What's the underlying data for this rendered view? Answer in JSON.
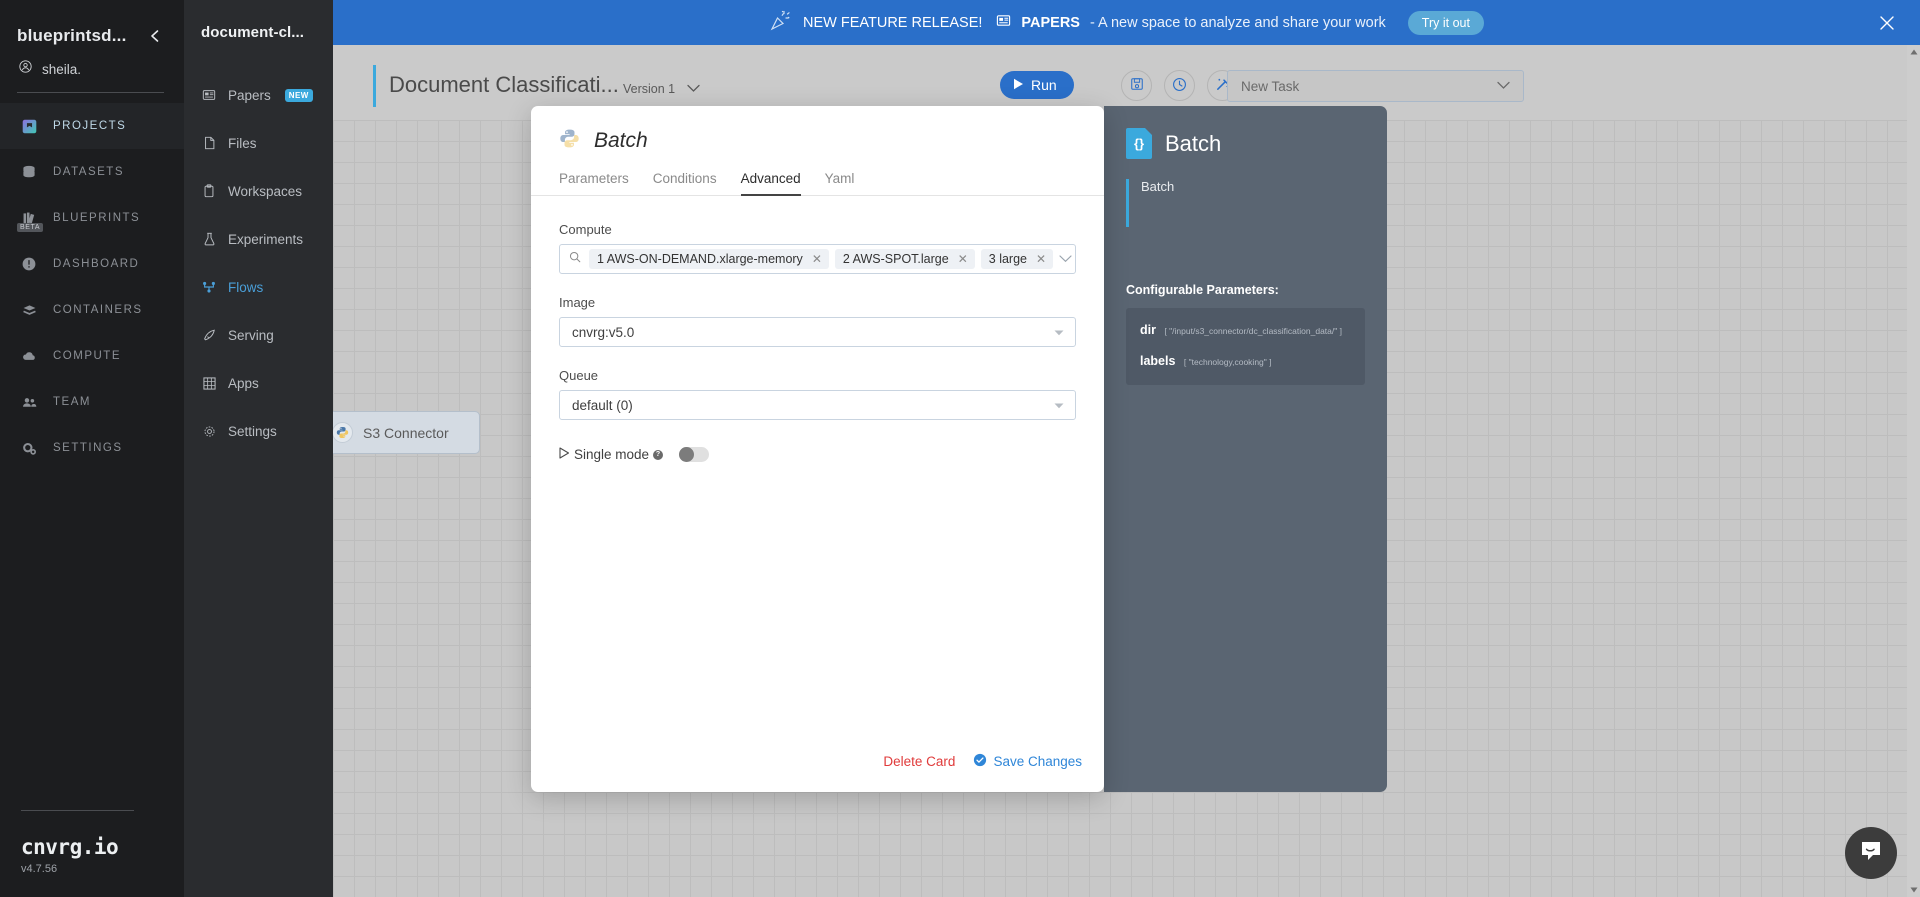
{
  "sidebar_primary": {
    "org_name": "blueprintsd...",
    "user_name": "sheila.",
    "collapse_icon": "chevron-left-icon",
    "user_icon": "user-circle-icon",
    "items": [
      {
        "label": "PROJECTS",
        "icon": "projects-icon",
        "active": true,
        "badge": ""
      },
      {
        "label": "DATASETS",
        "icon": "database-icon",
        "active": false,
        "badge": ""
      },
      {
        "label": "BLUEPRINTS",
        "icon": "books-icon",
        "active": false,
        "badge": "BETA"
      },
      {
        "label": "DASHBOARD",
        "icon": "gauge-icon",
        "active": false,
        "badge": ""
      },
      {
        "label": "CONTAINERS",
        "icon": "containers-icon",
        "active": false,
        "badge": ""
      },
      {
        "label": "COMPUTE",
        "icon": "cloud-icon",
        "active": false,
        "badge": ""
      },
      {
        "label": "TEAM",
        "icon": "team-icon",
        "active": false,
        "badge": ""
      },
      {
        "label": "SETTINGS",
        "icon": "gears-icon",
        "active": false,
        "badge": ""
      }
    ],
    "brand": "cnvrg.io",
    "version": "v4.7.56"
  },
  "sidebar_secondary": {
    "project_title": "document-cl...",
    "items": [
      {
        "label": "Papers",
        "icon": "papers-icon",
        "active": false,
        "badge": "NEW"
      },
      {
        "label": "Files",
        "icon": "file-icon",
        "active": false,
        "badge": ""
      },
      {
        "label": "Workspaces",
        "icon": "clipboard-icon",
        "active": false,
        "badge": ""
      },
      {
        "label": "Experiments",
        "icon": "flask-icon",
        "active": false,
        "badge": ""
      },
      {
        "label": "Flows",
        "icon": "flows-icon",
        "active": true,
        "badge": ""
      },
      {
        "label": "Serving",
        "icon": "rocket-icon",
        "active": false,
        "badge": ""
      },
      {
        "label": "Apps",
        "icon": "grid-icon",
        "active": false,
        "badge": ""
      },
      {
        "label": "Settings",
        "icon": "gear-icon",
        "active": false,
        "badge": ""
      }
    ]
  },
  "banner": {
    "icon": "party-popper-icon",
    "headline": "NEW FEATURE RELEASE!",
    "papers_icon": "papers-icon",
    "product": "PAPERS",
    "tagline": "- A new space to analyze and share your work",
    "cta_label": "Try it out",
    "close_icon": "close-icon",
    "bg_color": "#2a6fc9",
    "cta_color": "#5aa9d6"
  },
  "toolbar": {
    "flow_title": "Document Classificati...",
    "version_label": "Version 1",
    "version_caret": "chevron-down-icon",
    "run_label": "Run",
    "run_icon": "play-icon",
    "accent_color": "#3ba9dd",
    "run_color": "#2a6fc9",
    "icon_buttons": [
      {
        "name": "save-flow-button",
        "icon": "save-icon"
      },
      {
        "name": "history-button",
        "icon": "clock-icon"
      },
      {
        "name": "magic-button",
        "icon": "magic-wand-icon"
      },
      {
        "name": "code-button",
        "icon": "code-brackets-icon"
      }
    ],
    "new_task_value": "New Task",
    "new_task_caret": "chevron-down-icon"
  },
  "canvas": {
    "node": {
      "label": "S3 Connector",
      "icon": "python-icon"
    },
    "scroll_up_icon": "caret-up-icon",
    "scroll_down_icon": "caret-down-icon"
  },
  "modal": {
    "icon": "python-icon",
    "title": "Batch",
    "tabs": [
      {
        "label": "Parameters",
        "active": false
      },
      {
        "label": "Conditions",
        "active": false
      },
      {
        "label": "Advanced",
        "active": true
      },
      {
        "label": "Yaml",
        "active": false
      }
    ],
    "compute": {
      "label": "Compute",
      "search_icon": "search-icon",
      "caret": "chevron-down-icon",
      "chips": [
        "1 AWS-ON-DEMAND.xlarge-memory",
        "2 AWS-SPOT.large",
        "3 large"
      ],
      "chip_remove_icon": "close-small-icon"
    },
    "image": {
      "label": "Image",
      "value": "cnvrg:v5.0",
      "caret": "caret-down-icon"
    },
    "queue": {
      "label": "Queue",
      "value": "default (0)",
      "caret": "caret-down-icon"
    },
    "single_mode": {
      "play_icon": "play-outline-icon",
      "label": "Single mode",
      "help_icon": "help-icon",
      "enabled": false
    },
    "footer": {
      "delete_label": "Delete Card",
      "save_label": "Save Changes",
      "save_icon": "check-circle-icon",
      "delete_color": "#e03b3b",
      "save_color": "#2f86d8"
    }
  },
  "info_panel": {
    "icon": "json-file-icon",
    "title": "Batch",
    "description": "Batch",
    "accent_color": "#3ba9dd",
    "cfg_title": "Configurable Parameters:",
    "parameters": [
      {
        "key": "dir",
        "value": "[ \"/input/s3_connector/dc_classification_data/\" ]"
      },
      {
        "key": "labels",
        "value": "[ \"technology,cooking\" ]"
      }
    ]
  },
  "intercom": {
    "icon": "chat-bubble-icon"
  }
}
